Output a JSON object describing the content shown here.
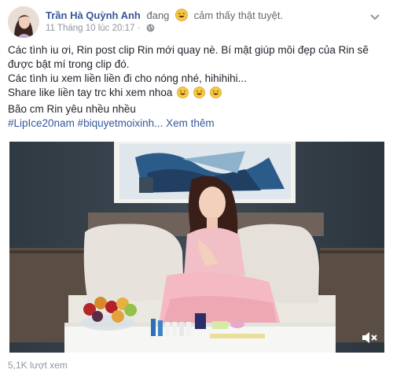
{
  "post": {
    "author": "Trần Hà Quỳnh Anh",
    "verb": "đang",
    "feeling": "cảm thấy thật tuyệt.",
    "timestamp": "11 Tháng 10 lúc 20:17",
    "separator": "·",
    "lines": [
      "Các tình iu ơi, Rin post clip Rin mới quay nè. Bí mật giúp môi đẹp của Rin sẽ",
      "được bật mí trong clip đó.",
      "Các tình iu xem liền liền đi cho nóng nhé, hihihihi...",
      "Share like liền tay trc khi xem nhoa",
      "Bão cm Rin yêu nhều nhều"
    ],
    "hashtags": "#LipIce20nam #biquyetmoixinh...",
    "see_more": "Xem thêm",
    "views": "5,1K lượt xem"
  },
  "icons": {
    "avatar": "avatar-photo",
    "feeling": "smiling-face-icon",
    "audience": "globe-icon",
    "options": "chevron-down-icon",
    "mute": "speaker-muted-icon"
  },
  "colors": {
    "link": "#365899",
    "meta": "#90949c",
    "text": "#1d2129"
  }
}
